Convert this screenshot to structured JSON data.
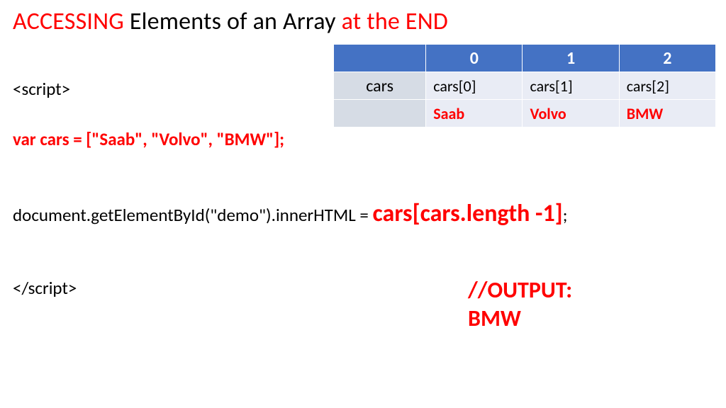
{
  "title": {
    "part1": "ACCESSING",
    "part2": " Elements of an Array ",
    "part3": "at the END"
  },
  "code": {
    "open_tag": "<script>",
    "var_decl": "var cars = [\"Saab\", \"Volvo\", \"BMW\"];",
    "stmt_left": "document.getElementById(\"demo\").innerHTML = ",
    "stmt_expr": "cars[cars.length -1]",
    "stmt_semicolon": ";",
    "close_tag": "</script>"
  },
  "output": {
    "comment": "//OUTPUT:",
    "value": "BMW"
  },
  "table": {
    "label": "cars",
    "headers": [
      "0",
      "1",
      "2"
    ],
    "refs": [
      "cars[0]",
      "cars[1]",
      "cars[2]"
    ],
    "values": [
      "Saab",
      "Volvo",
      "BMW"
    ]
  }
}
